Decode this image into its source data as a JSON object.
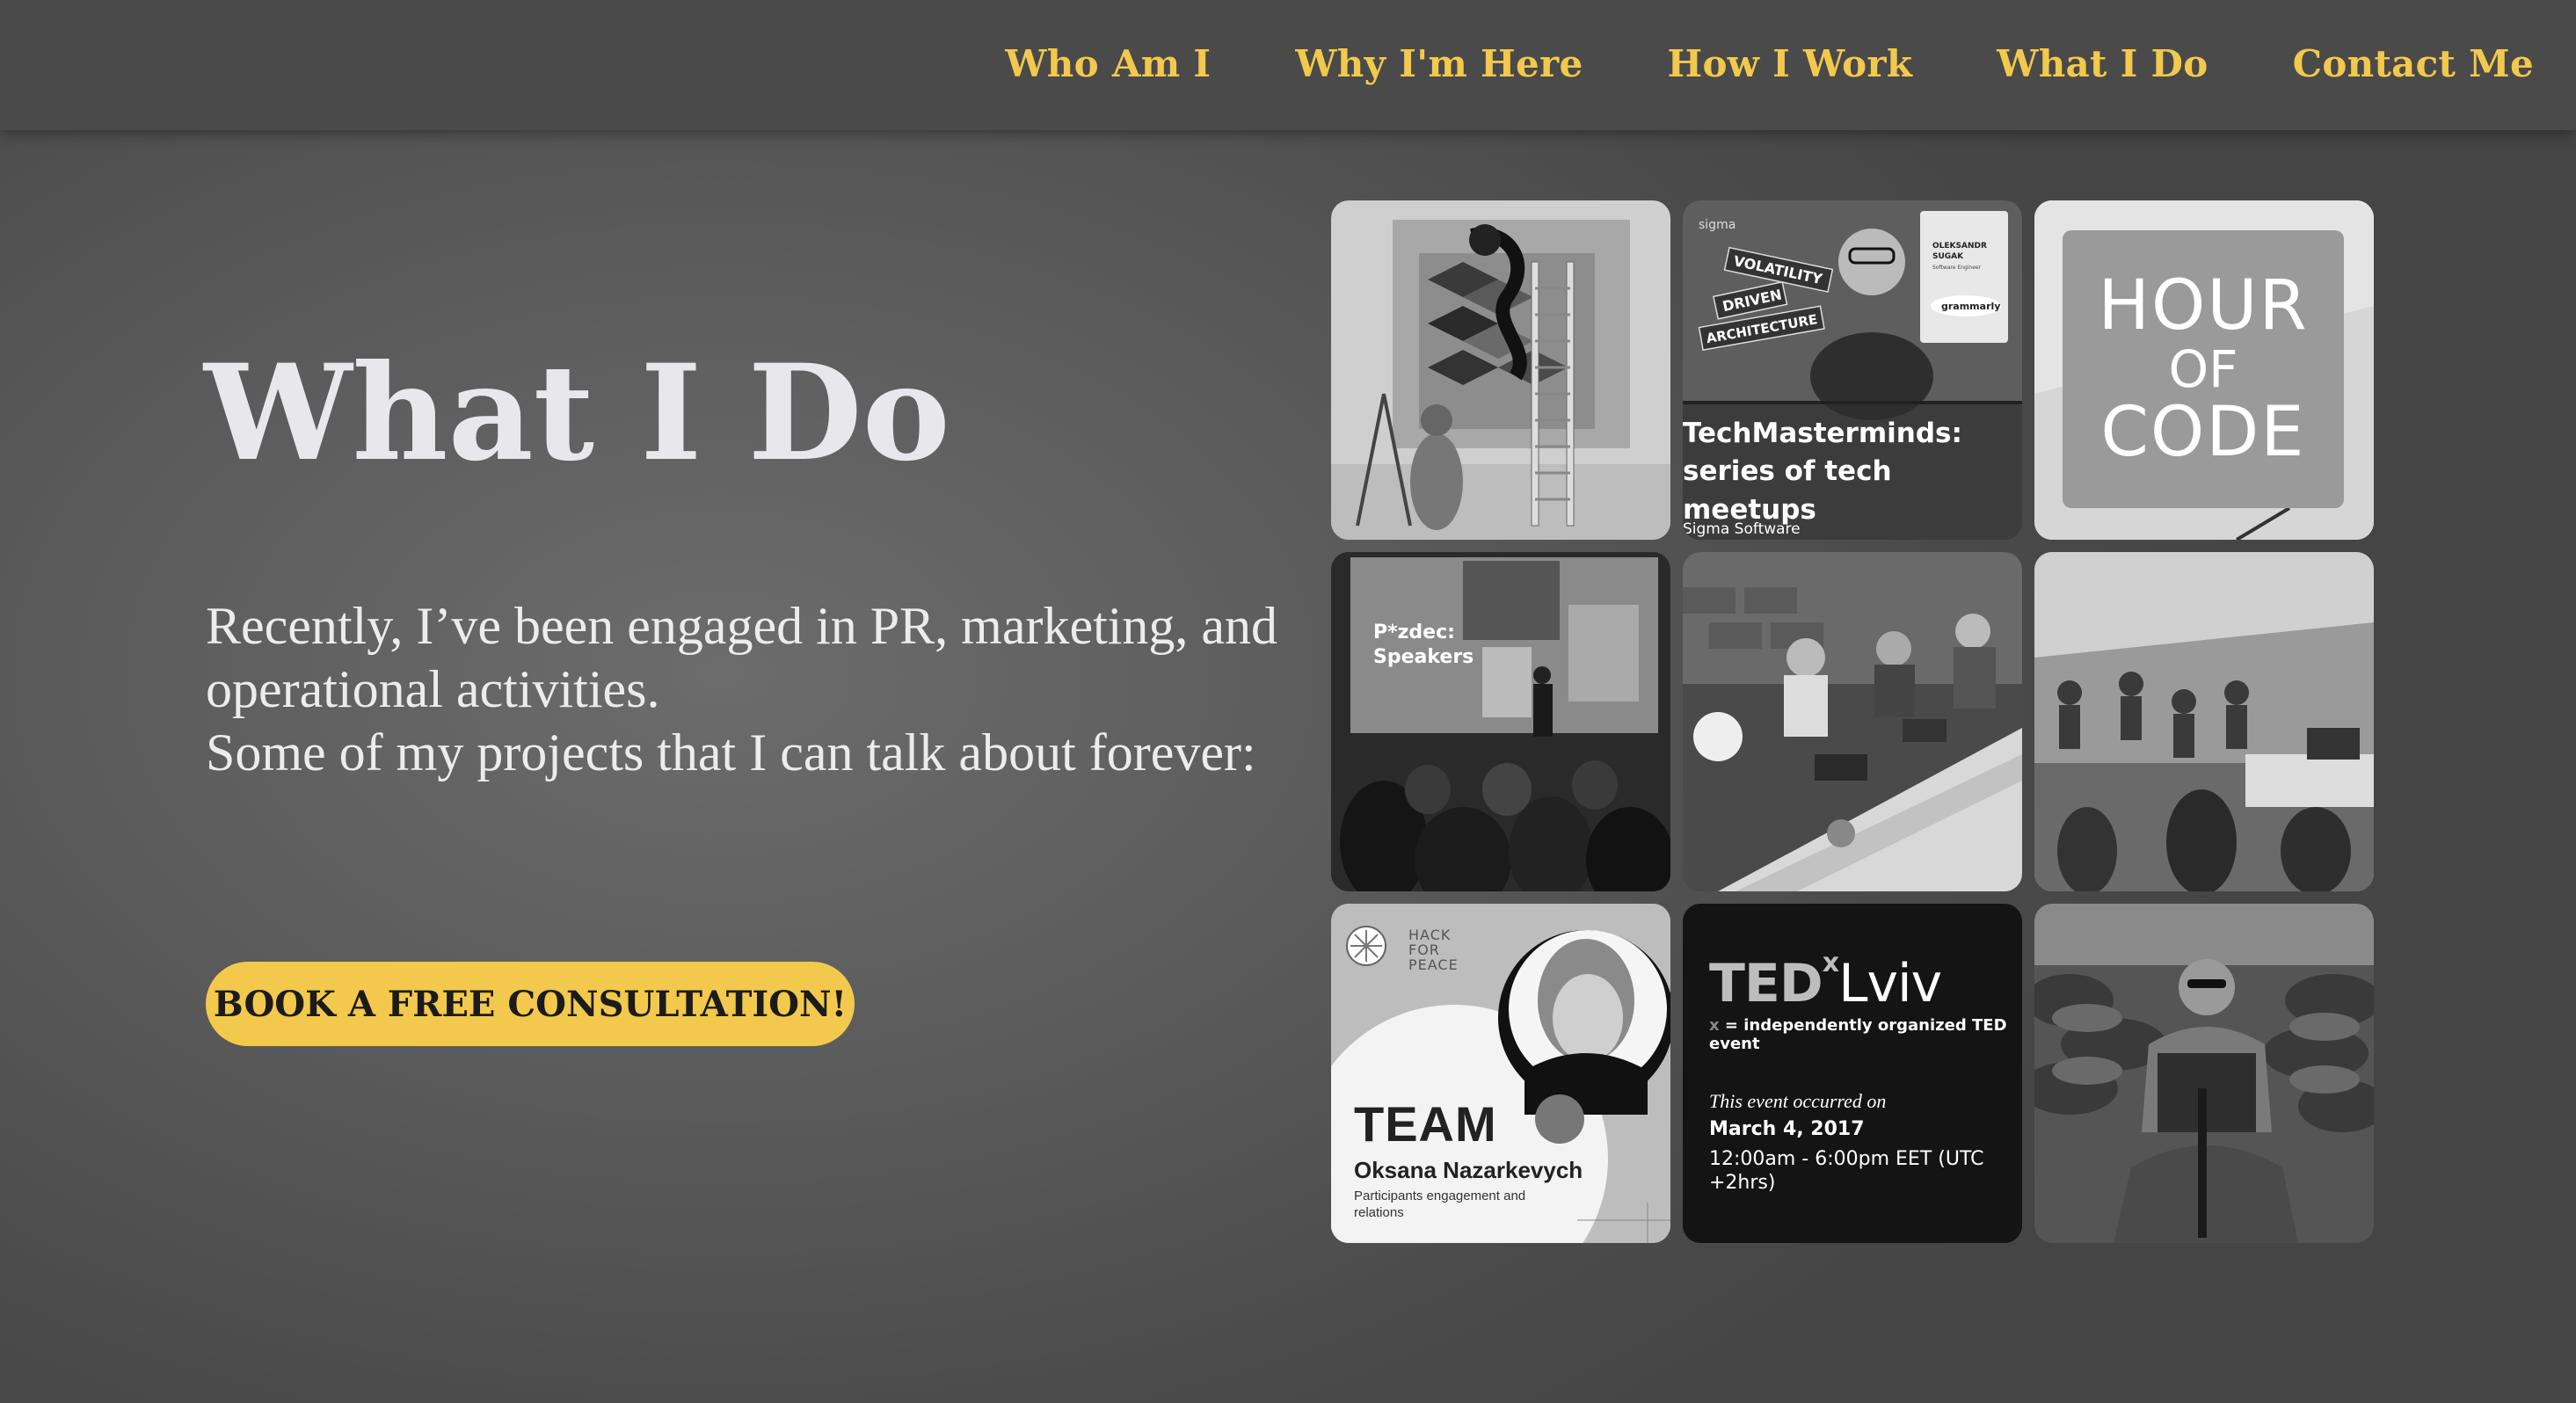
{
  "nav": {
    "items": [
      "Who Am I",
      "Why I'm Here",
      "How I Work",
      "What I Do",
      "Contact Me"
    ]
  },
  "hero": {
    "title": "What I Do",
    "paragraph1": "Recently, I’ve been engaged in PR, marketing, and operational activities.",
    "paragraph2": "Some of my projects that I can talk about forever:",
    "cta_label": "BOOK A FREE CONSULTATION!"
  },
  "gallery": {
    "techmasterminds": {
      "title": "TechMasterminds: series of tech meetups",
      "org": "Sigma Software",
      "badge_1": "VOLATILITY",
      "badge_2": "DRIVEN",
      "badge_3": "ARCHITECTURE",
      "logo": "sigma",
      "speaker_first": "OLEKSANDR",
      "speaker_last": "SUGAK",
      "speaker_role": "Software Engineer",
      "company": "grammarly"
    },
    "hour_of_code": {
      "line1": "HOUR",
      "line2": "OF",
      "line3": "CODE"
    },
    "speakers": {
      "label": "P*zdec: Speakers"
    },
    "hack_for_peace": {
      "logo_line1": "HACK",
      "logo_line2": "FOR",
      "logo_line3": "PEACE",
      "team": "TEAM",
      "name": "Oksana Nazarkevych",
      "role": "Participants engagement and relations"
    },
    "tedx": {
      "ted": "TED",
      "x": "x",
      "city": "Lviv",
      "subtitle_x": "x",
      "subtitle": " = independently organized TED event",
      "occurred": "This event occurred on",
      "date": "March 4, 2017",
      "time": "12:00am - 6:00pm EET (UTC +2hrs)"
    }
  },
  "colors": {
    "accent": "#f2c94c",
    "background": "#5a5a5a",
    "title": "#e8e8ec"
  }
}
